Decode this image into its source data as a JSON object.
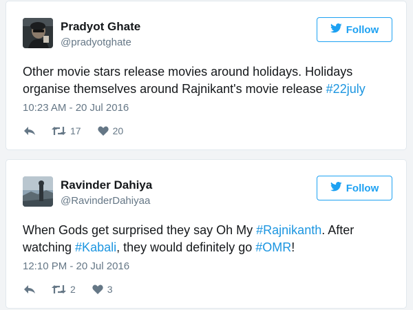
{
  "colors": {
    "accent": "#1da1f2",
    "hashtag": "#1b95e0",
    "text": "#14171a",
    "muted": "#657786",
    "border": "#e1e8ed"
  },
  "tweets": [
    {
      "author": {
        "name": "Pradyot Ghate",
        "handle": "@pradyotghate",
        "avatar_icon": "avatar-photo-dark"
      },
      "follow_label": "Follow",
      "text": {
        "line1": "Other movie stars release movies around holidays. Holidays",
        "line2_part1": "organise themselves around Rajnikant's movie release ",
        "line2_tag1": "#22july"
      },
      "timestamp": "10:23 AM - 20 Jul 2016",
      "retweets": "17",
      "likes": "20"
    },
    {
      "author": {
        "name": "Ravinder Dahiya",
        "handle": "@RavinderDahiyaa",
        "avatar_icon": "avatar-photo-landscape"
      },
      "follow_label": "Follow",
      "text": {
        "line1_part1": "When Gods get surprised they say Oh My ",
        "line1_tag1": "#Rajnikanth",
        "line1_part2": ". After",
        "line2_part1": "watching ",
        "line2_tag1": "#Kabali",
        "line2_part2": ", they would definitely go ",
        "line2_tag2": "#OMR",
        "line2_part3": "!"
      },
      "timestamp": "12:10 PM - 20 Jul 2016",
      "retweets": "2",
      "likes": "3"
    }
  ]
}
